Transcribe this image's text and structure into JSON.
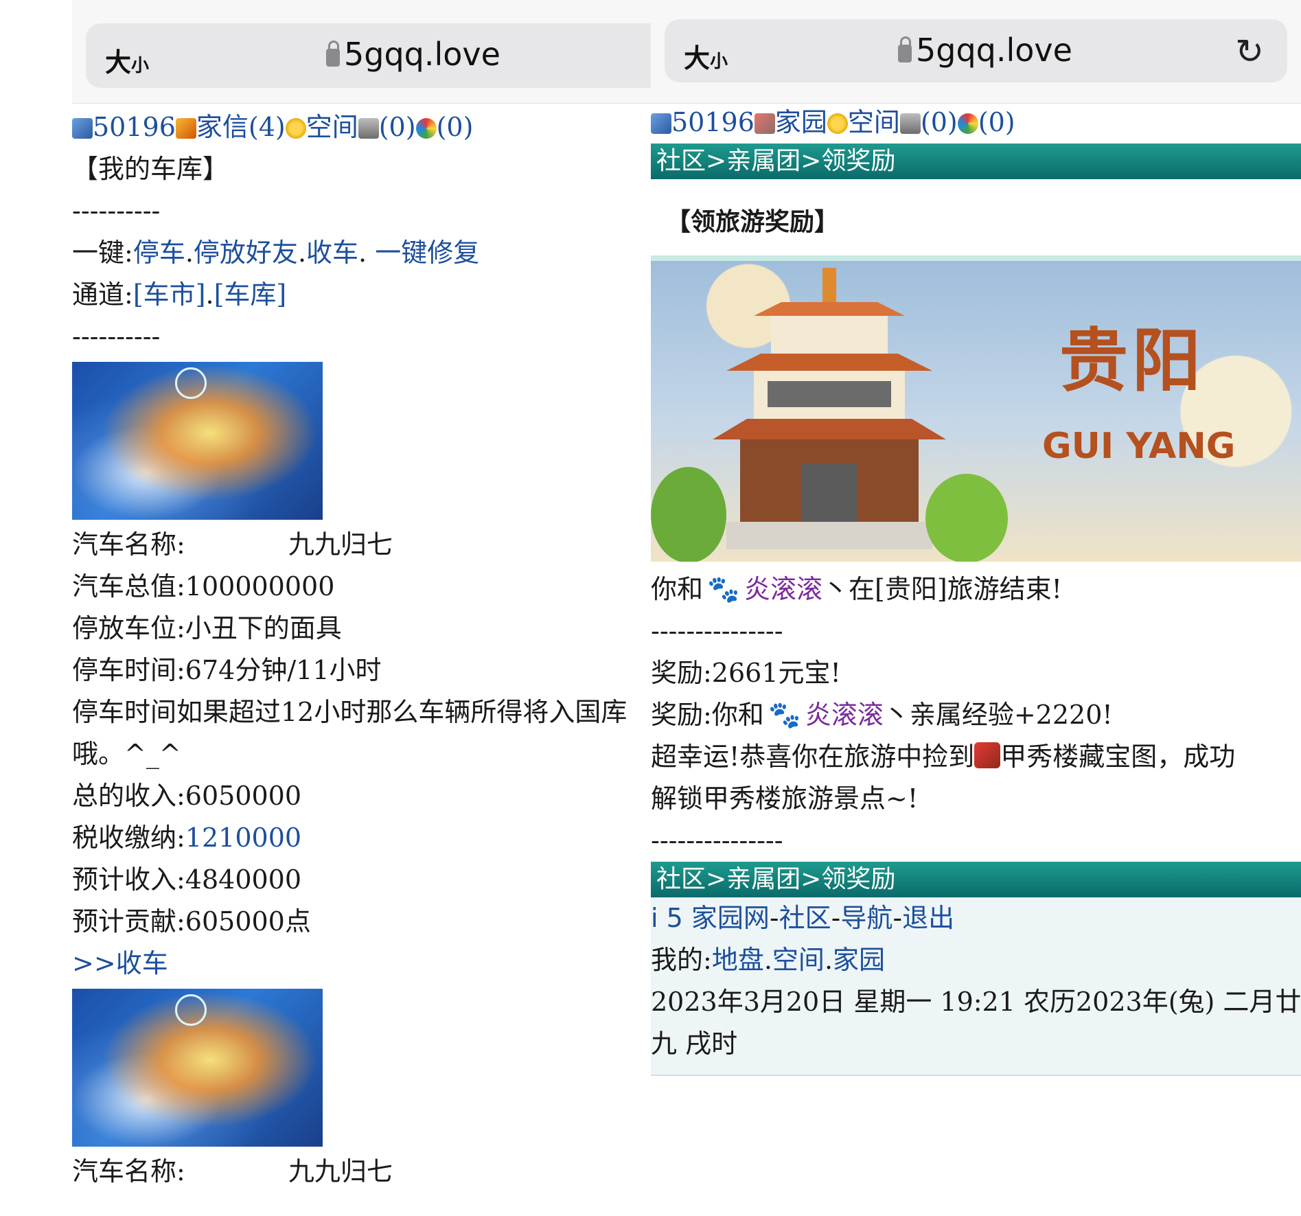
{
  "left": {
    "browser": {
      "size_label": "大",
      "size_small": "小",
      "host": "5gqq.love"
    },
    "topbar": {
      "id": "50196",
      "mail": "家信(4)",
      "space": "空间",
      "bank": "(0)",
      "wheel": "(0)"
    },
    "title": "【我的车库】",
    "sep1": "----------",
    "quick_prefix": "一键:",
    "quick_links": {
      "park": "停车",
      "park_friend": "停放好友",
      "collect": "收车",
      "repair": "一键修复"
    },
    "channel_prefix": "通道:",
    "channel_links": {
      "market": "[车市]",
      "garage": "[车库]"
    },
    "sep2": "----------",
    "car1": {
      "name_label": "汽车名称:",
      "name_value": "九九归七",
      "total_value": "汽车总值:100000000",
      "spot": "停放车位:小丑下的面具",
      "time": "停车时间:674分钟/11小时",
      "warning1": "停车时间如果超过12小时那么车辆所得将入国库",
      "warning2": "哦。^_^",
      "income": "总的收入:6050000",
      "tax_label": "税收缴纳:",
      "tax_value": "1210000",
      "expected": "预计收入:4840000",
      "contribution": "预计贡献:605000点",
      "collect_prefix": ">>",
      "collect_link": "收车"
    },
    "car2": {
      "name_label": "汽车名称:",
      "name_value": "九九归七"
    }
  },
  "right": {
    "browser": {
      "size_label": "大",
      "size_small": "小",
      "host": "5gqq.love",
      "reload_icon": "↻"
    },
    "topbar": {
      "id": "50196",
      "home": "家园",
      "space": "空间",
      "bank": "(0)",
      "wheel": "(0)"
    },
    "breadcrumb": "社区>亲属团>领奖励",
    "section_title": "【领旅游奖励】",
    "banner": {
      "city_cn": "贵阳",
      "city_en": "GUI YANG"
    },
    "msg": {
      "prefix": "你和",
      "user": "炎滚滚",
      "suffix": "丶在[贵阳]旅游结束!",
      "sep": "---------------",
      "reward1": "奖励:2661元宝!",
      "reward2_prefix": "奖励:你和",
      "reward2_user": "炎滚滚",
      "reward2_suffix": "丶亲属经验+2220!",
      "lucky_prefix": "超幸运!恭喜你在旅游中捡到",
      "lucky_suffix": "甲秀楼藏宝图，成功",
      "lucky_line2": "解锁甲秀楼旅游景点~!",
      "sep2": "---------------"
    },
    "footer": {
      "breadcrumb": "社区>亲属团>领奖励",
      "site": "i 5 家园网",
      "community": "社区",
      "nav": "导航",
      "logout": "退出",
      "mine_prefix": "我的:",
      "mine_links": {
        "land": "地盘",
        "space": "空间",
        "home": "家园"
      },
      "datetime1": "2023年3月20日  星期一  19:21  农历2023年(兔)  二月廿",
      "datetime2": "九  戌时"
    }
  }
}
